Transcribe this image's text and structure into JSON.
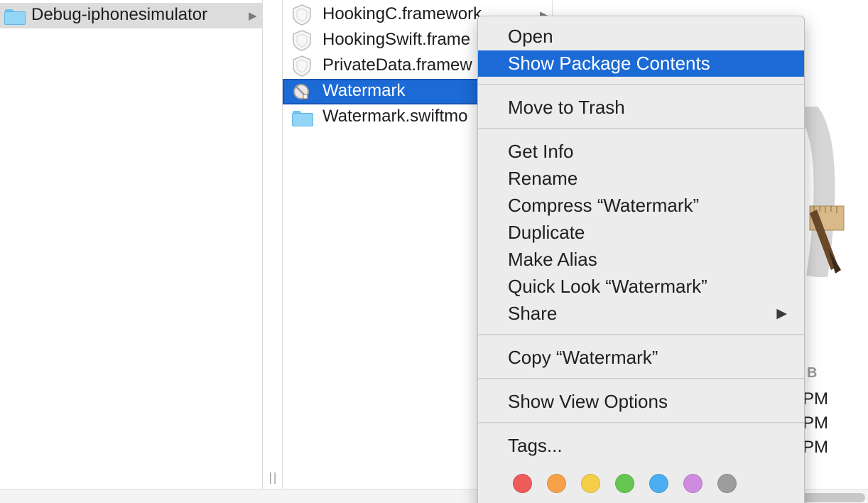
{
  "column1": {
    "items": [
      {
        "label": "Debug-iphonesimulator",
        "icon": "folder-icon",
        "selected": true
      }
    ]
  },
  "column2": {
    "items": [
      {
        "label": "HookingC.framework",
        "icon": "framework-icon"
      },
      {
        "label": "HookingSwift.frame",
        "icon": "framework-icon"
      },
      {
        "label": "PrivateData.framew",
        "icon": "framework-icon"
      },
      {
        "label": "Watermark",
        "icon": "no-entry-app-icon",
        "selected": true
      },
      {
        "label": "Watermark.swiftmo",
        "icon": "folder-icon"
      }
    ]
  },
  "preview": {
    "size_fragment": "B",
    "times": [
      "PM",
      "PM",
      "PM"
    ]
  },
  "context_menu": {
    "groups": [
      [
        "Open",
        "Show Package Contents"
      ],
      [
        "Move to Trash"
      ],
      [
        "Get Info",
        "Rename",
        "Compress “Watermark”",
        "Duplicate",
        "Make Alias",
        "Quick Look “Watermark”",
        "Share"
      ],
      [
        "Copy “Watermark”"
      ],
      [
        "Show View Options"
      ],
      [
        "Tags..."
      ]
    ],
    "highlighted": "Show Package Contents",
    "submenu_indicator": "▶",
    "tag_colors": [
      {
        "name": "red",
        "color": "#ee5b5a"
      },
      {
        "name": "orange",
        "color": "#f6a149"
      },
      {
        "name": "yellow",
        "color": "#f5ce4a"
      },
      {
        "name": "green",
        "color": "#65c651"
      },
      {
        "name": "blue",
        "color": "#4aaef0"
      },
      {
        "name": "purple",
        "color": "#cf8be0"
      },
      {
        "name": "gray",
        "color": "#9d9d9d"
      }
    ]
  },
  "colors": {
    "selection_blue": "#1b6ad6",
    "selection_grey": "#dcdcdc",
    "menu_bg": "#ececec"
  }
}
